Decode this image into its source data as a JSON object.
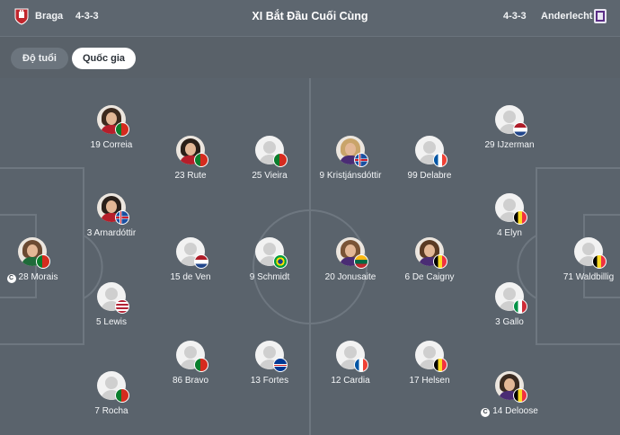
{
  "header": {
    "home_team": "Braga",
    "home_formation": "4-3-3",
    "title": "XI Bắt Đầu Cuối Cùng",
    "away_formation": "4-3-3",
    "away_team": "Anderlecht"
  },
  "toolbar": {
    "age_label": "Độ tuổi",
    "nationality_label": "Quốc gia"
  },
  "home_players": [
    {
      "label": "28 Morais",
      "flag": "portugal",
      "captain": true,
      "photo": true
    },
    {
      "label": "19 Correia",
      "flag": "portugal",
      "photo": true
    },
    {
      "label": "3 Arnardóttir",
      "flag": "iceland",
      "photo": true
    },
    {
      "label": "5 Lewis",
      "flag": "usa"
    },
    {
      "label": "7 Rocha",
      "flag": "portugal"
    },
    {
      "label": "23 Rute",
      "flag": "portugal",
      "photo": true
    },
    {
      "label": "15 de Ven",
      "flag": "netherlands"
    },
    {
      "label": "86 Bravo",
      "flag": "portugal"
    },
    {
      "label": "25 Vieira",
      "flag": "portugal"
    },
    {
      "label": "9 Schmidt",
      "flag": "brazil"
    },
    {
      "label": "13 Fortes",
      "flag": "capeverde"
    }
  ],
  "away_players": [
    {
      "label": "9 Kristjánsdóttir",
      "flag": "iceland",
      "photo": true
    },
    {
      "label": "20 Jonusaite",
      "flag": "lithuania",
      "photo": true
    },
    {
      "label": "12 Cardia",
      "flag": "france"
    },
    {
      "label": "99 Delabre",
      "flag": "france"
    },
    {
      "label": "6 De Caigny",
      "flag": "belgium",
      "photo": true
    },
    {
      "label": "17 Helsen",
      "flag": "belgium"
    },
    {
      "label": "29 IJzerman",
      "flag": "netherlands"
    },
    {
      "label": "4 Elyn",
      "flag": "belgium"
    },
    {
      "label": "3 Gallo",
      "flag": "italy"
    },
    {
      "label": "14 Deloose",
      "flag": "belgium",
      "captain": true,
      "photo": true
    },
    {
      "label": "71 Waldbillig",
      "flag": "belgium"
    }
  ],
  "colors": {
    "pitch": "#5a636c",
    "lines": "#6e7780",
    "header": "#5d666f"
  }
}
